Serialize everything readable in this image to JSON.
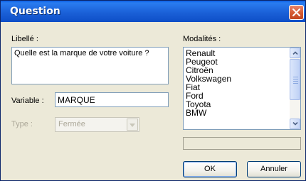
{
  "window": {
    "title": "Question"
  },
  "form": {
    "libelle_label": "Libellé :",
    "libelle_value": "Quelle est la marque de votre voiture ?",
    "variable_label": "Variable :",
    "variable_value": "MARQUE",
    "type_label": "Type :",
    "type_value": "Fermée"
  },
  "modalites": {
    "label": "Modalités :",
    "items": [
      "Renault",
      "Peugeot",
      "Citroën",
      "Volkswagen",
      "Fiat",
      "Ford",
      "Toyota",
      "BMW"
    ]
  },
  "buttons": {
    "ok": "OK",
    "cancel": "Annuler"
  },
  "colors": {
    "titlebar": "#1b61d8",
    "close": "#d45a32",
    "dialog_bg": "#ece9d8",
    "field_border": "#7f9db9"
  }
}
